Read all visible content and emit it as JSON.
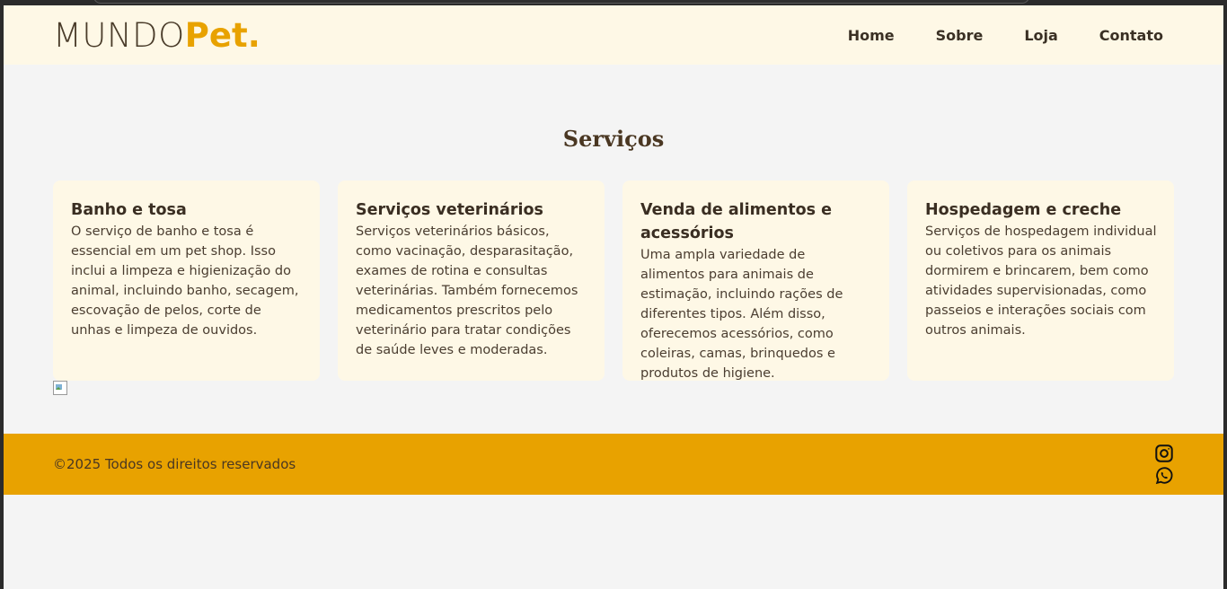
{
  "logo": {
    "part1": "MUNDO",
    "part2": "Pet."
  },
  "nav": [
    {
      "label": "Home"
    },
    {
      "label": "Sobre"
    },
    {
      "label": "Loja"
    },
    {
      "label": "Contato"
    }
  ],
  "services": {
    "title": "Serviços",
    "cards": [
      {
        "title": "Banho e tosa",
        "text": "O serviço de banho e tosa é essencial em um pet shop. Isso inclui a limpeza e higienização do animal, incluindo banho, secagem, escovação de pelos, corte de unhas e limpeza de ouvidos."
      },
      {
        "title": "Serviços veterinários",
        "text": "Serviços veterinários básicos, como vacinação, desparasitação, exames de rotina e consultas veterinárias. Também fornecemos medicamentos prescritos pelo veterinário para tratar condições de saúde leves e moderadas."
      },
      {
        "title": "Venda de alimentos e acessórios",
        "text": "Uma ampla variedade de alimentos para animais de estimação, incluindo rações de diferentes tipos. Além disso, oferecemos acessórios, como coleiras, camas, brinquedos e produtos de higiene."
      },
      {
        "title": "Hospedagem e creche",
        "text": "Serviços de hospedagem individual ou coletivos para os animais dormirem e brincarem, bem como atividades supervisionadas, como passeios e interações sociais com outros animais."
      }
    ]
  },
  "footer": {
    "copyright": "©2025 Todos os direitos reservados",
    "icons": [
      "instagram-icon",
      "whatsapp-icon"
    ]
  },
  "colors": {
    "accent": "#e8a200",
    "header_bg": "#fef8e6",
    "text_dark": "#3a2e22"
  }
}
